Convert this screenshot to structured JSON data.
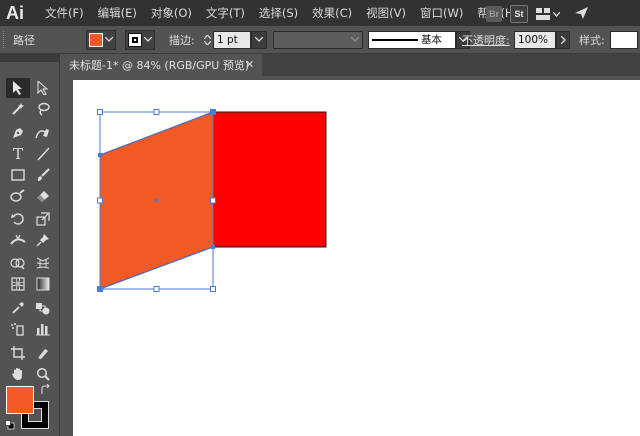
{
  "app": {
    "logo": "Ai"
  },
  "menu": [
    "文件(F)",
    "编辑(E)",
    "对象(O)",
    "文字(T)",
    "选择(S)",
    "效果(C)",
    "视图(V)",
    "窗口(W)",
    "帮助(H)"
  ],
  "menu_right": {
    "bridge": "Br",
    "stock": "St"
  },
  "control": {
    "selection_type": "路径",
    "stroke_label": "描边:",
    "stroke_weight": "1 pt",
    "profile_label": "基本",
    "opacity_label": "不透明度:",
    "opacity_value": "100%",
    "style_label": "样式:"
  },
  "colors": {
    "fill": "#f15a24",
    "stroke": "#000000",
    "parallelogram": "#f15a24",
    "square": "#ff0000",
    "selection": "#4a7bd6"
  },
  "document": {
    "tab_title": "未标题-1* @ 84% (RGB/GPU 预览)"
  }
}
